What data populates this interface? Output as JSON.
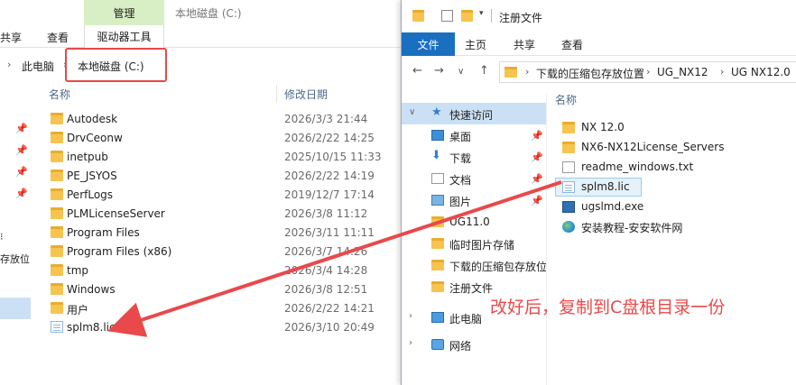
{
  "left_window": {
    "manage_tab": "管理",
    "window_title": "本地磁盘 (C:)",
    "ribbon": {
      "share": "共享",
      "view": "查看",
      "drive_tools": "驱动器工具"
    },
    "address": {
      "this_pc": "此电脑",
      "current": "本地磁盘 (C:)"
    },
    "nav": {
      "partial_text": "存放位"
    },
    "columns": {
      "name": "名称",
      "modified": "修改日期"
    },
    "files": [
      {
        "name": "Autodesk",
        "date": "2026/3/3 21:44",
        "type": "folder"
      },
      {
        "name": "DrvCeonw",
        "date": "2026/2/22 14:25",
        "type": "folder"
      },
      {
        "name": "inetpub",
        "date": "2025/10/15 11:33",
        "type": "folder"
      },
      {
        "name": "PE_JSYOS",
        "date": "2026/2/22 14:19",
        "type": "folder"
      },
      {
        "name": "PerfLogs",
        "date": "2019/12/7 17:14",
        "type": "folder"
      },
      {
        "name": "PLMLicenseServer",
        "date": "2026/3/8 11:12",
        "type": "folder"
      },
      {
        "name": "Program Files",
        "date": "2026/3/11 11:11",
        "type": "folder"
      },
      {
        "name": "Program Files (x86)",
        "date": "2026/3/7 14:26",
        "type": "folder"
      },
      {
        "name": "tmp",
        "date": "2026/3/4 14:28",
        "type": "folder"
      },
      {
        "name": "Windows",
        "date": "2026/3/8 12:51",
        "type": "folder"
      },
      {
        "name": "用户",
        "date": "2026/2/22 14:21",
        "type": "folder"
      },
      {
        "name": "splm8.lic",
        "date": "2026/3/10 20:49",
        "type": "lic"
      }
    ]
  },
  "right_window": {
    "title": "注册文件",
    "ribbon": {
      "file": "文件",
      "home": "主页",
      "share": "共享",
      "view": "查看"
    },
    "address": {
      "crumbs": [
        "下载的压缩包存放位置",
        "UG_NX12",
        "UG NX12.0"
      ]
    },
    "nav": [
      {
        "label": "快速访问",
        "icon": "star-icon",
        "pinned": false
      },
      {
        "label": "桌面",
        "icon": "desktop-icon",
        "pinned": true
      },
      {
        "label": "下载",
        "icon": "download-icon",
        "pinned": true
      },
      {
        "label": "文档",
        "icon": "document-icon",
        "pinned": true
      },
      {
        "label": "图片",
        "icon": "picture-icon",
        "pinned": true
      },
      {
        "label": "UG11.0",
        "icon": "folder-icon",
        "pinned": false
      },
      {
        "label": "临时图片存储",
        "icon": "folder-icon",
        "pinned": false
      },
      {
        "label": "下载的压缩包存放位",
        "icon": "folder-icon",
        "pinned": false
      },
      {
        "label": "注册文件",
        "icon": "folder-icon",
        "pinned": false
      },
      {
        "label": "此电脑",
        "icon": "computer-icon",
        "pinned": false
      },
      {
        "label": "网络",
        "icon": "network-icon",
        "pinned": false
      }
    ],
    "columns": {
      "name": "名称"
    },
    "files": [
      {
        "name": "NX 12.0",
        "type": "folder"
      },
      {
        "name": "NX6-NX12License_Servers",
        "type": "folder"
      },
      {
        "name": "readme_windows.txt",
        "type": "txt"
      },
      {
        "name": "splm8.lic",
        "type": "lic",
        "selected": true
      },
      {
        "name": "ugslmd.exe",
        "type": "exe"
      },
      {
        "name": "安装教程-安安软件网",
        "type": "web"
      }
    ]
  },
  "annotation": {
    "text": "改好后，复制到C盘根目录一份",
    "color": "#e9494a"
  }
}
